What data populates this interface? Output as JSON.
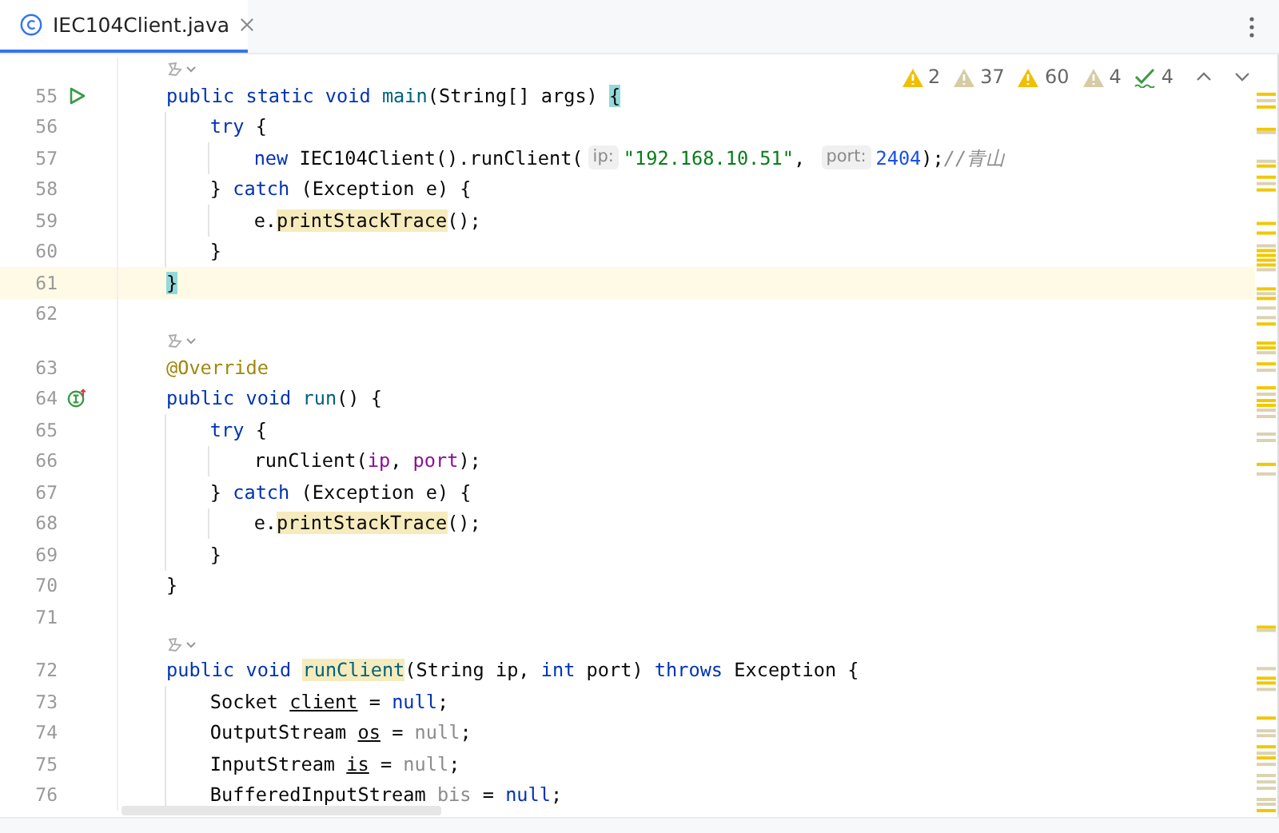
{
  "tab": {
    "title": "IEC104Client.java",
    "selected": true
  },
  "inspections": [
    {
      "kind": "error",
      "count": "2"
    },
    {
      "kind": "weak",
      "count": "37"
    },
    {
      "kind": "error",
      "count": "60"
    },
    {
      "kind": "weak",
      "count": "4"
    },
    {
      "kind": "typo",
      "count": "4"
    }
  ],
  "lines": [
    {
      "kind": "vision"
    },
    {
      "kind": "code",
      "number": "55",
      "gutter": {
        "kind": "run"
      },
      "current": false,
      "tokens": [
        {
          "kind": "kw",
          "text": "public static void "
        },
        {
          "kind": "method",
          "text": "main"
        },
        {
          "kind": "plain",
          "text": "(String[] args) "
        },
        {
          "kind": "brace-match",
          "text": "{"
        }
      ]
    },
    {
      "kind": "code",
      "number": "56",
      "current": false,
      "tokens": [
        {
          "kind": "indent"
        },
        {
          "kind": "kw",
          "text": "try"
        },
        {
          "kind": "plain",
          "text": " {"
        }
      ]
    },
    {
      "kind": "code",
      "number": "57",
      "current": false,
      "tokens": [
        {
          "kind": "indent"
        },
        {
          "kind": "indent"
        },
        {
          "kind": "kw",
          "text": "new"
        },
        {
          "kind": "plain",
          "text": " IEC104Client().runClient("
        },
        {
          "kind": "hint",
          "text": "ip:"
        },
        {
          "kind": "string",
          "text": "\"192.168.10.51\""
        },
        {
          "kind": "plain",
          "text": ", "
        },
        {
          "kind": "hint",
          "text": "port:"
        },
        {
          "kind": "number",
          "text": "2404"
        },
        {
          "kind": "plain",
          "text": ");"
        },
        {
          "kind": "comment",
          "text": "//青山"
        }
      ]
    },
    {
      "kind": "code",
      "number": "58",
      "current": false,
      "tokens": [
        {
          "kind": "indent"
        },
        {
          "kind": "plain",
          "text": "} "
        },
        {
          "kind": "kw",
          "text": "catch"
        },
        {
          "kind": "plain",
          "text": " (Exception e) {"
        }
      ]
    },
    {
      "kind": "code",
      "number": "59",
      "current": false,
      "tokens": [
        {
          "kind": "indent"
        },
        {
          "kind": "indent"
        },
        {
          "kind": "plain",
          "text": "e."
        },
        {
          "kind": "usage",
          "text": "printStackTrace"
        },
        {
          "kind": "plain",
          "text": "();"
        }
      ]
    },
    {
      "kind": "code",
      "number": "60",
      "current": false,
      "tokens": [
        {
          "kind": "indent"
        },
        {
          "kind": "plain",
          "text": "}"
        }
      ]
    },
    {
      "kind": "code",
      "number": "61",
      "current": true,
      "tokens": [
        {
          "kind": "brace-match",
          "text": "}"
        }
      ]
    },
    {
      "kind": "code",
      "number": "62",
      "current": false
    },
    {
      "kind": "vision"
    },
    {
      "kind": "code",
      "number": "63",
      "current": false,
      "tokens": [
        {
          "kind": "annotation",
          "text": "@Override"
        }
      ]
    },
    {
      "kind": "code",
      "number": "64",
      "gutter": {
        "kind": "implements"
      },
      "current": false,
      "tokens": [
        {
          "kind": "kw",
          "text": "public void "
        },
        {
          "kind": "method",
          "text": "run"
        },
        {
          "kind": "plain",
          "text": "() {"
        }
      ]
    },
    {
      "kind": "code",
      "number": "65",
      "current": false,
      "tokens": [
        {
          "kind": "indent"
        },
        {
          "kind": "kw",
          "text": "try"
        },
        {
          "kind": "plain",
          "text": " {"
        }
      ]
    },
    {
      "kind": "code",
      "number": "66",
      "current": false,
      "tokens": [
        {
          "kind": "indent"
        },
        {
          "kind": "indent"
        },
        {
          "kind": "plain",
          "text": "runClient("
        },
        {
          "kind": "field",
          "text": "ip"
        },
        {
          "kind": "plain",
          "text": ", "
        },
        {
          "kind": "field",
          "text": "port"
        },
        {
          "kind": "plain",
          "text": ");"
        }
      ]
    },
    {
      "kind": "code",
      "number": "67",
      "current": false,
      "tokens": [
        {
          "kind": "indent"
        },
        {
          "kind": "plain",
          "text": "} "
        },
        {
          "kind": "kw",
          "text": "catch"
        },
        {
          "kind": "plain",
          "text": " (Exception e) {"
        }
      ]
    },
    {
      "kind": "code",
      "number": "68",
      "current": false,
      "tokens": [
        {
          "kind": "indent"
        },
        {
          "kind": "indent"
        },
        {
          "kind": "plain",
          "text": "e."
        },
        {
          "kind": "usage",
          "text": "printStackTrace"
        },
        {
          "kind": "plain",
          "text": "();"
        }
      ]
    },
    {
      "kind": "code",
      "number": "69",
      "current": false,
      "tokens": [
        {
          "kind": "indent"
        },
        {
          "kind": "plain",
          "text": "}"
        }
      ]
    },
    {
      "kind": "code",
      "number": "70",
      "current": false,
      "tokens": [
        {
          "kind": "plain",
          "text": "}"
        }
      ]
    },
    {
      "kind": "code",
      "number": "71",
      "current": false
    },
    {
      "kind": "vision"
    },
    {
      "kind": "code",
      "number": "72",
      "current": false,
      "tokens": [
        {
          "kind": "kw",
          "text": "public void "
        },
        {
          "kind": "method-usage",
          "text": "runClient"
        },
        {
          "kind": "plain",
          "text": "(String ip, "
        },
        {
          "kind": "kw",
          "text": "int"
        },
        {
          "kind": "plain",
          "text": " port) "
        },
        {
          "kind": "kw",
          "text": "throws"
        },
        {
          "kind": "plain",
          "text": " Exception {"
        }
      ]
    },
    {
      "kind": "code",
      "number": "73",
      "current": false,
      "tokens": [
        {
          "kind": "indent"
        },
        {
          "kind": "plain",
          "text": "Socket "
        },
        {
          "kind": "reassigned",
          "text": "client"
        },
        {
          "kind": "plain",
          "text": " = "
        },
        {
          "kind": "kw",
          "text": "null"
        },
        {
          "kind": "plain",
          "text": ";"
        }
      ]
    },
    {
      "kind": "code",
      "number": "74",
      "current": false,
      "tokens": [
        {
          "kind": "indent"
        },
        {
          "kind": "plain",
          "text": "OutputStream "
        },
        {
          "kind": "reassigned",
          "text": "os"
        },
        {
          "kind": "plain",
          "text": " = "
        },
        {
          "kind": "unused",
          "text": "null"
        },
        {
          "kind": "plain",
          "text": ";"
        }
      ]
    },
    {
      "kind": "code",
      "number": "75",
      "current": false,
      "tokens": [
        {
          "kind": "indent"
        },
        {
          "kind": "plain",
          "text": "InputStream "
        },
        {
          "kind": "reassigned",
          "text": "is"
        },
        {
          "kind": "plain",
          "text": " = "
        },
        {
          "kind": "unused",
          "text": "null"
        },
        {
          "kind": "plain",
          "text": ";"
        }
      ]
    },
    {
      "kind": "code",
      "number": "76",
      "current": false,
      "tokens": [
        {
          "kind": "indent"
        },
        {
          "kind": "plain",
          "text": "BufferedInputStream "
        },
        {
          "kind": "unused",
          "text": "bis"
        },
        {
          "kind": "plain",
          "text": " = "
        },
        {
          "kind": "kw",
          "text": "null"
        },
        {
          "kind": "plain",
          "text": ";"
        }
      ]
    }
  ]
}
